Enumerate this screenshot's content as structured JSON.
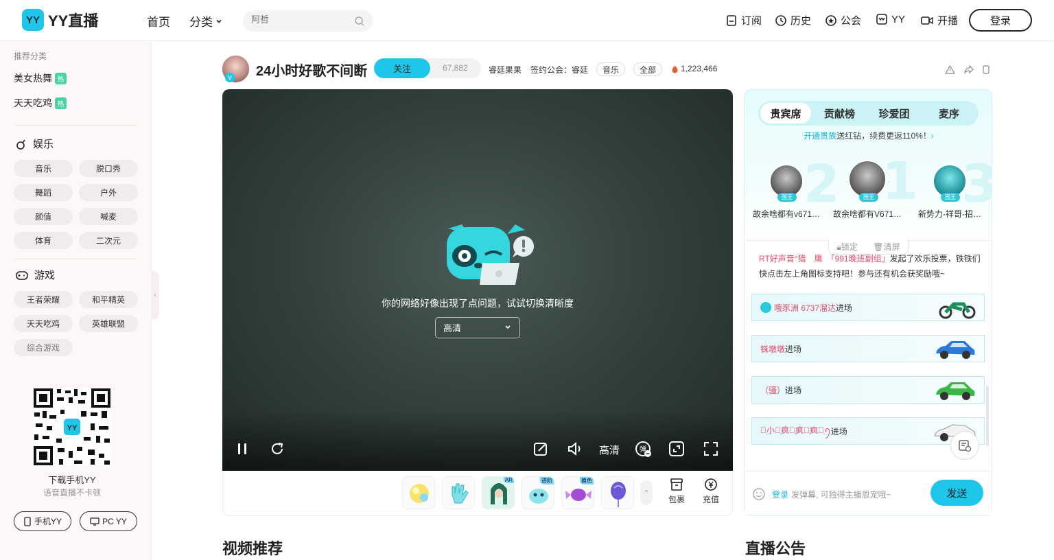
{
  "header": {
    "logo_badge": "YY",
    "logo_text": "YY直播",
    "nav_home": "首页",
    "nav_category": "分类",
    "search_placeholder": "阿哲",
    "subscribe": "订阅",
    "history": "历史",
    "guild": "公会",
    "yy": "YY",
    "broadcast": "开播",
    "login": "登录"
  },
  "sidebar": {
    "recommended_title": "推荐分类",
    "recommended": [
      {
        "label": "美女热舞",
        "badge": "热"
      },
      {
        "label": "天天吃鸡",
        "badge": "热"
      }
    ],
    "entertainment_title": "娱乐",
    "entertainment": [
      "音乐",
      "脱口秀",
      "舞蹈",
      "户外",
      "颜值",
      "喊麦",
      "体育",
      "二次元"
    ],
    "games_title": "游戏",
    "games": [
      "王者荣耀",
      "和平精英",
      "天天吃鸡",
      "英雄联盟",
      "综合游戏"
    ],
    "download_title": "下载手机YY",
    "download_sub": "语音直播不卡顿",
    "mobile_btn": "手机YY",
    "pc_btn": "PC YY"
  },
  "room": {
    "title": "24小时好歌不间断",
    "follow_label": "关注",
    "followers": "67,882",
    "anchor": "睿廷果果",
    "guild_label": "签约公会：睿廷",
    "tag1": "音乐",
    "tag2": "全部",
    "heat": "1,223,466"
  },
  "player": {
    "error_message": "你的网络好像出现了点问题，试试切换清晰度",
    "quality_select": "高清",
    "quality_label": "高清"
  },
  "gifts": {
    "tags": [
      "AR",
      "进阶",
      "换色"
    ],
    "bag_label": "包裹",
    "recharge_label": "充值"
  },
  "chat": {
    "tabs": [
      "贵宾席",
      "贡献榜",
      "珍爱团",
      "麦序"
    ],
    "promo_link": "开通贵族",
    "promo_text": "送红钻，续费更返110%！",
    "rank": [
      {
        "num": "2",
        "name": "故余啥都有v671…",
        "badge": "国王"
      },
      {
        "num": "1",
        "name": "故余啥都有V671…",
        "badge": "国王"
      },
      {
        "num": "3",
        "name": "新势力-祥哥-招…",
        "badge": "国王"
      }
    ],
    "lock": "锁定",
    "clear": "清屏",
    "message_names": "RT好声音°猎　鹰　「991晚班副组」",
    "message_text": "发起了欢乐投票，铁铁们快点击左上角图标支持吧！参与还有机会获奖励哦~",
    "entries": [
      {
        "name": "哦豕洲 6737溜达",
        "suffix": "进场"
      },
      {
        "name": "铢墩墩",
        "suffix": "进场"
      },
      {
        "name": "（骚）",
        "suffix": "进场"
      },
      {
        "name": "勋᷂小ོ᷂疯ོ᷂疯ོ᷂疯ོ᷂ꪆ",
        "suffix": "进场"
      }
    ],
    "input_login": "登录",
    "input_hint": "发弹幕, 可独得主播恩宠哦~",
    "send": "发送"
  },
  "sections": {
    "video_recommend": "视频推荐",
    "announcement": "直播公告"
  },
  "colors": {
    "accent": "#1ec7ea",
    "hot_badge": "#49d3a2",
    "name_red": "#e24a6a"
  }
}
